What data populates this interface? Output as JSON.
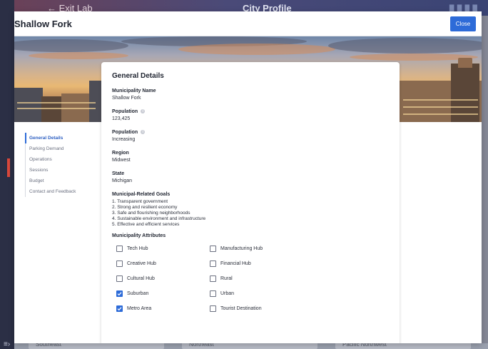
{
  "background_app": {
    "exit_label": "← Exit Lab",
    "title": "City Profile",
    "bottom_cards": [
      "Southeast",
      "Northeast",
      "Pacific Northwest"
    ]
  },
  "modal": {
    "title": "Shallow Fork",
    "close_label": "Close"
  },
  "side_nav": {
    "items": [
      {
        "label": "General Details",
        "active": true
      },
      {
        "label": "Parking Demand",
        "active": false
      },
      {
        "label": "Operations",
        "active": false
      },
      {
        "label": "Sessions",
        "active": false
      },
      {
        "label": "Budget",
        "active": false
      },
      {
        "label": "Contact and Feedback",
        "active": false
      }
    ]
  },
  "card": {
    "title": "General Details",
    "fields": [
      {
        "label": "Municipality Name",
        "value": "Shallow Fork",
        "info": false
      },
      {
        "label": "Population",
        "value": "123,425",
        "info": true
      },
      {
        "label": "Population",
        "value": "Increasing",
        "info": true
      },
      {
        "label": "Region",
        "value": "Midwest",
        "info": false
      },
      {
        "label": "State",
        "value": "Michigan",
        "info": false
      }
    ],
    "goals_label": "Municipal-Related Goals",
    "goals": [
      "1. Transparent government",
      "2. Strong and resilient economy",
      "3. Safe and flourishing neighborhoods",
      "4. Sustainable environment and infrastructure",
      "5. Effective and efficient services"
    ],
    "attributes_label": "Municipality Attributes",
    "attributes": [
      {
        "label": "Tech Hub",
        "checked": false
      },
      {
        "label": "Manufacturing Hub",
        "checked": false
      },
      {
        "label": "Creative Hub",
        "checked": false
      },
      {
        "label": "Financial Hub",
        "checked": false
      },
      {
        "label": "Cultural Hub",
        "checked": false
      },
      {
        "label": "Rural",
        "checked": false
      },
      {
        "label": "Suburban",
        "checked": true
      },
      {
        "label": "Urban",
        "checked": false
      },
      {
        "label": "Metro Area",
        "checked": true
      },
      {
        "label": "Tourist Destination",
        "checked": false
      }
    ]
  },
  "colors": {
    "accent": "#2d6bd8",
    "nav_active": "#2d5fc2"
  }
}
